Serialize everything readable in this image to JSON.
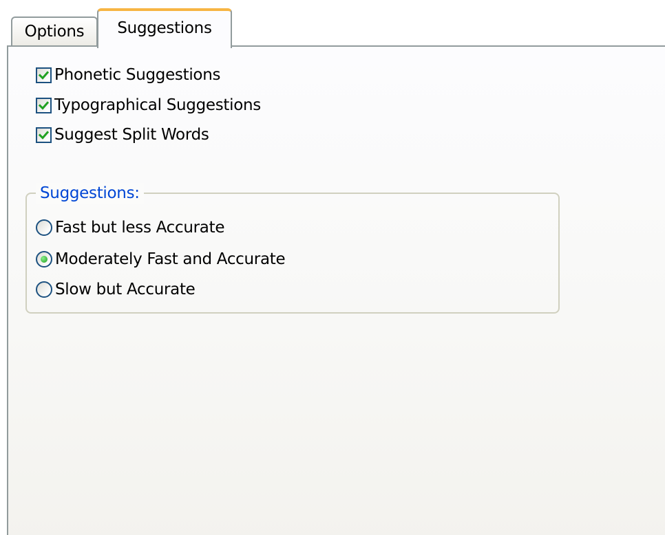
{
  "tabs": [
    {
      "label": "Options",
      "selected": false
    },
    {
      "label": "Suggestions",
      "selected": true
    }
  ],
  "checkboxes": [
    {
      "label": "Phonetic Suggestions",
      "checked": true
    },
    {
      "label": "Typographical Suggestions",
      "checked": true
    },
    {
      "label": "Suggest Split Words",
      "checked": true
    }
  ],
  "suggestions_group": {
    "title": "Suggestions:",
    "options": [
      {
        "label": "Fast but less Accurate",
        "selected": false
      },
      {
        "label": "Moderately Fast and Accurate",
        "selected": true
      },
      {
        "label": "Slow but Accurate",
        "selected": false
      }
    ]
  },
  "colors": {
    "check_mark": "#21a121",
    "group_title": "#0046d5",
    "selected_tab_accent": "#f7b543",
    "control_border": "#1c5180"
  }
}
